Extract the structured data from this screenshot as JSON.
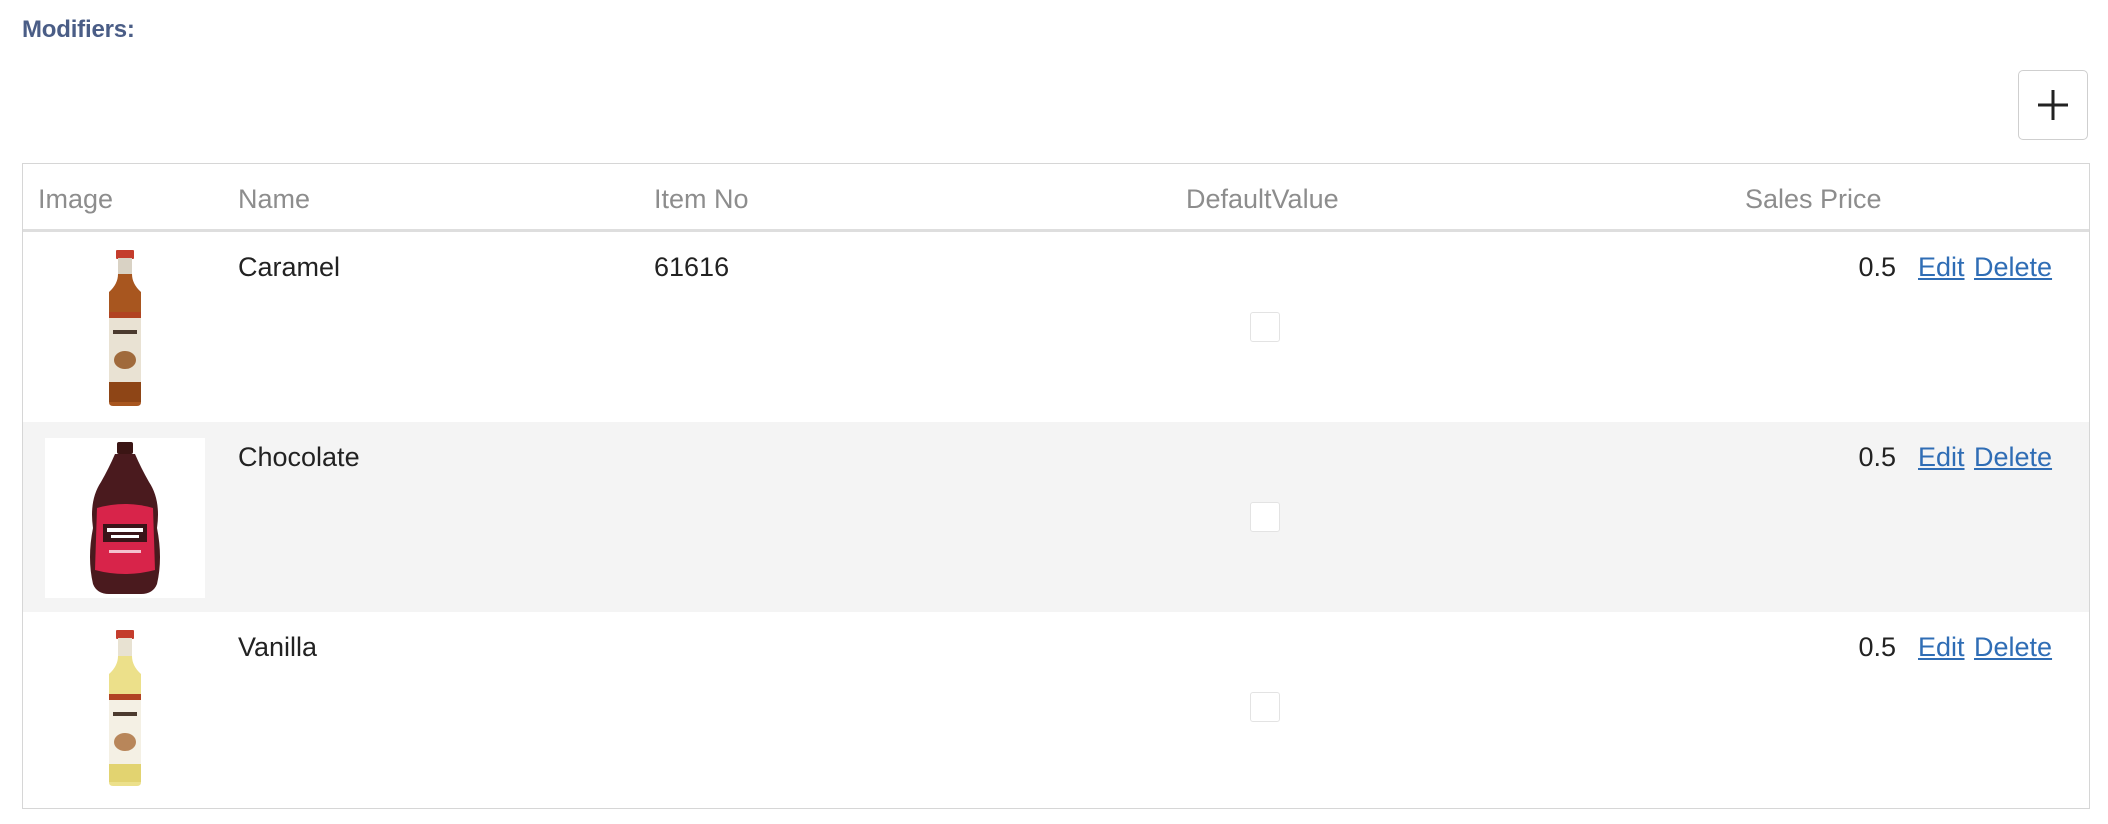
{
  "section": {
    "title": "Modifiers:"
  },
  "toolbar": {
    "add_icon": "plus-icon"
  },
  "table": {
    "headers": {
      "image": "Image",
      "name": "Name",
      "item_no": "Item No",
      "default_value": "DefaultValue",
      "sales_price": "Sales Price"
    },
    "rows": [
      {
        "name": "Caramel",
        "item_no": "61616",
        "default_value": false,
        "sales_price": "0.5",
        "image": "caramel-syrup-bottle",
        "edit_label": "Edit",
        "delete_label": "Delete"
      },
      {
        "name": "Chocolate",
        "item_no": "",
        "default_value": false,
        "sales_price": "0.5",
        "image": "chocolate-syrup-bottle",
        "edit_label": "Edit",
        "delete_label": "Delete"
      },
      {
        "name": "Vanilla",
        "item_no": "",
        "default_value": false,
        "sales_price": "0.5",
        "image": "vanilla-syrup-bottle",
        "edit_label": "Edit",
        "delete_label": "Delete"
      }
    ]
  },
  "colors": {
    "section_title": "#4a5d86",
    "header_text": "#8d8d8d",
    "link": "#2f6db5",
    "alt_row": "#f4f4f4",
    "border": "#d6d6d6"
  }
}
